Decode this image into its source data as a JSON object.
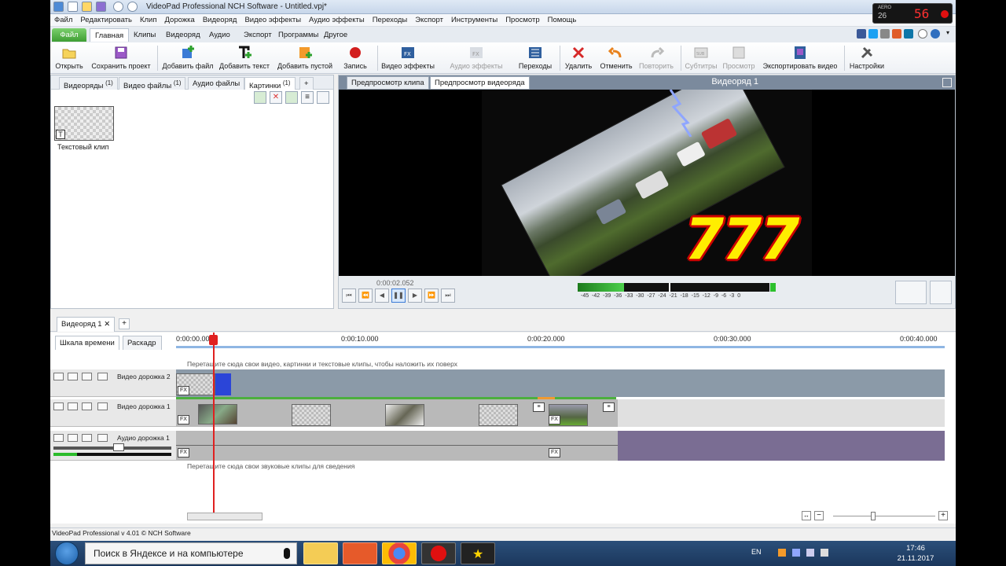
{
  "window": {
    "title": "VideoPad Professional NCH Software - Untitled.vpj*"
  },
  "menu": [
    "Файл",
    "Редактировать",
    "Клип",
    "Дорожка",
    "Видеоряд",
    "Видео эффекты",
    "Аудио эффекты",
    "Переходы",
    "Экспорт",
    "Инструменты",
    "Просмотр",
    "Помощь"
  ],
  "ribbon_tabs": [
    "Файл",
    "Главная",
    "Клипы",
    "Видеоряд",
    "Аудио",
    "Экспорт",
    "Программы",
    "Другое"
  ],
  "toolbar": {
    "open": "Открыть",
    "save_project": "Сохранить проект",
    "add_file": "Добавить файл",
    "add_text": "Добавить текст",
    "add_blank": "Добавить пустой",
    "record": "Запись",
    "video_effects": "Видео эффекты",
    "audio_effects": "Аудио эффекты",
    "transitions": "Переходы",
    "delete": "Удалить",
    "undo": "Отменить",
    "redo": "Повторить",
    "subtitles": "Субтитры",
    "preview": "Просмотр",
    "export_video": "Экспортировать видео",
    "settings": "Настройки"
  },
  "bin_tabs": [
    {
      "label": "Видеоряды",
      "count": "(1)"
    },
    {
      "label": "Видео файлы",
      "count": "(1)"
    },
    {
      "label": "Аудио файлы",
      "count": ""
    },
    {
      "label": "Картинки",
      "count": "(1)"
    },
    {
      "label": "+",
      "count": ""
    }
  ],
  "bin_item": {
    "caption": "Текстовый клип"
  },
  "preview": {
    "tab_clip": "Предпросмотр клипа",
    "tab_sequence": "Предпросмотр видеоряда",
    "title": "Видеоряд 1",
    "overlay_text": "777",
    "timecode": "0:00:02.052",
    "meter_labels": "-45 -42 -39 -36 -33 -30 -27 -24 -21 -18 -15 -12 -9 -6 -3 0",
    "meter_level": 0.24
  },
  "sequence": {
    "tab": "Видеоряд 1",
    "close": "✕",
    "add": "+"
  },
  "timeline": {
    "mode_timeline": "Шкала времени",
    "mode_storyboard": "Раскадр",
    "ruler": [
      "0:00:00.000",
      "0:00:10.000",
      "0:00:20.000",
      "0:00:30.000",
      "0:00:40.000"
    ],
    "hint_video": "Перетащите сюда свои видео, картинки и текстовые клипы, чтобы наложить их поверх",
    "hint_audio": "Перетащите сюда свои звуковые клипы для сведения",
    "tracks": {
      "video2": "Видео дорожка 2",
      "video1": "Видео дорожка 1",
      "audio1": "Аудио дорожка 1"
    },
    "fx": "FX"
  },
  "status": "VideoPad Professional v 4.01 © NCH Software",
  "corner_overlay": {
    "a": "AERO",
    "b": "26",
    "c": "56"
  },
  "taskbar": {
    "search": "Поиск в Яндексе и на компьютере",
    "lang": "EN",
    "time": "17:46",
    "date": "21.11.2017"
  },
  "colors": {
    "accent_green": "#4caf3e",
    "video_track": "#8b9aa8",
    "audio_track": "#7a6d93",
    "playhead": "#e02020"
  }
}
